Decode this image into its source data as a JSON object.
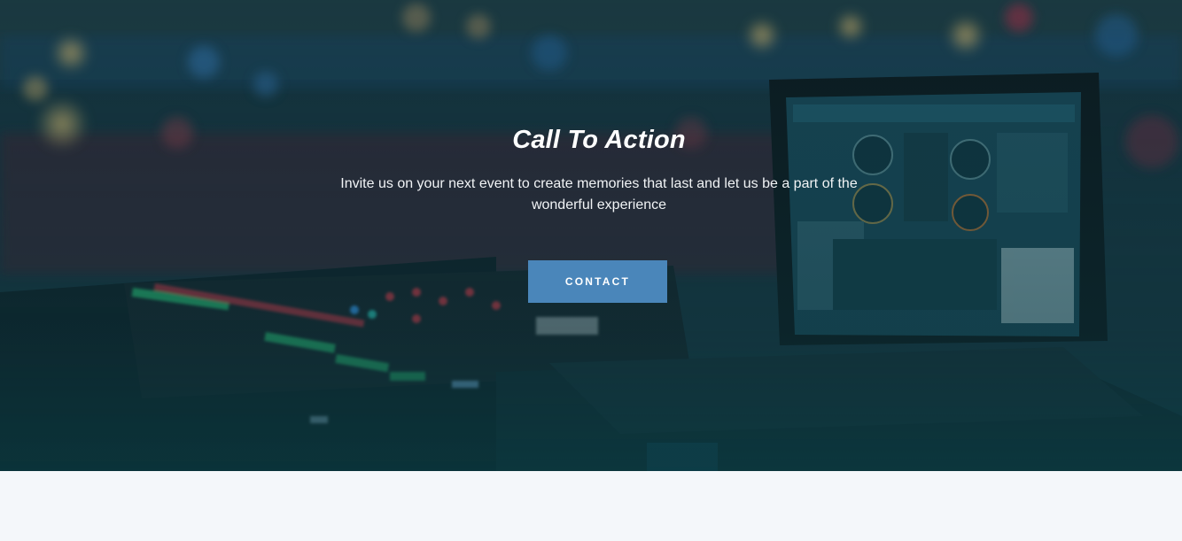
{
  "hero": {
    "title": "Call To Action",
    "subtitle": "Invite us on your next event to create memories that last and let us be a part of the wonderful experience",
    "cta_label": "CONTACT",
    "background_image": "dj-mixer-laptop-photo"
  },
  "colors": {
    "overlay": "#14343a",
    "button": "#4a86ba",
    "text": "#ffffff",
    "page_background": "#f4f7fa"
  }
}
